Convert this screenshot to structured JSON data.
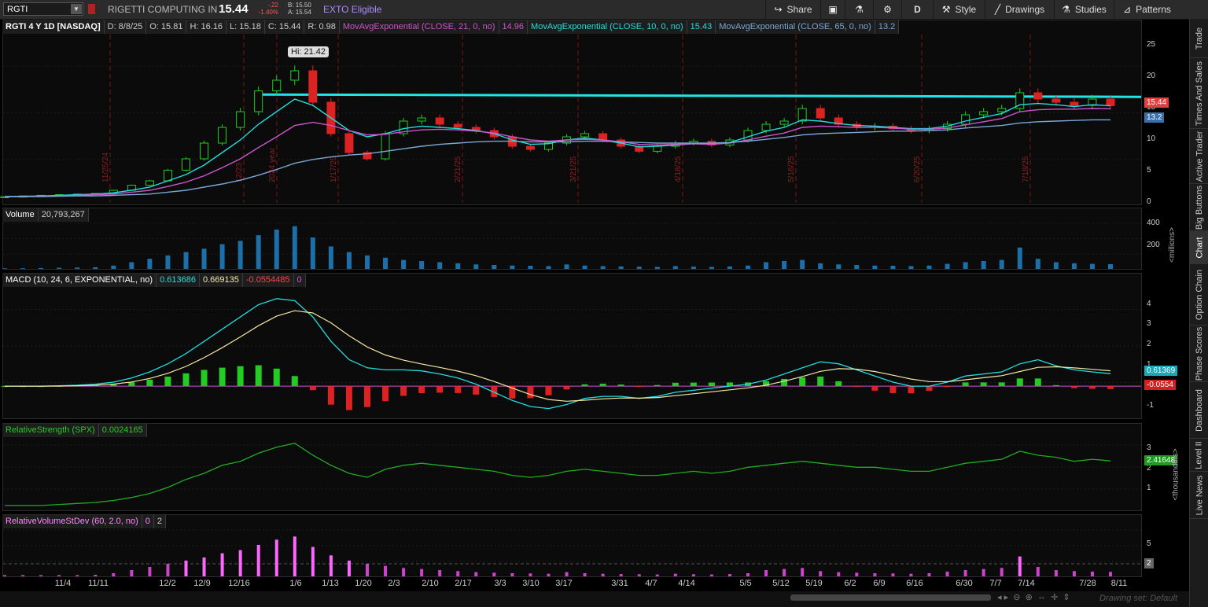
{
  "toolbar": {
    "symbol": "RGTI",
    "company": "RIGETTI COMPUTING IN",
    "last": "15.44",
    "change": "-.22",
    "change_pct": "-1.40%",
    "bid": "B: 15.50",
    "ask": "A: 15.54",
    "exto": "EXTO Eligible",
    "share": "Share",
    "period": "D",
    "style": "Style",
    "drawings": "Drawings",
    "studies": "Studies",
    "patterns": "Patterns"
  },
  "price_panel": {
    "header": {
      "title": "RGTI 4 Y 1D [NASDAQ]",
      "date": "D: 8/8/25",
      "open": "O: 15.81",
      "high": "H: 16.16",
      "low": "L: 15.18",
      "close": "C: 15.44",
      "range": "R: 0.98",
      "ema21_label": "MovAvgExponential (CLOSE, 21, 0, no)",
      "ema21_value": "14.96",
      "ema10_label": "MovAvgExponential (CLOSE, 10, 0, no)",
      "ema10_value": "15.43",
      "ema65_label": "MovAvgExponential (CLOSE, 65, 0, no)",
      "ema65_value": "13.2"
    },
    "hi_bubble": "Hi: 21.42",
    "y_ticks": [
      "25",
      "20",
      "15",
      "10",
      "5",
      "0"
    ],
    "price_tag": "15.44",
    "ema65_tag": "13.2",
    "event_labels": [
      "11/25/24",
      "12/23",
      "2024 year",
      "1/17/25",
      "2/21/25",
      "3/21/25",
      "4/18/25",
      "5/16/25",
      "6/20/25",
      "7/18/25"
    ],
    "resistance_level": 17.1
  },
  "volume_panel": {
    "title": "Volume",
    "value": "20,793,267",
    "y_ticks": [
      "400",
      "200"
    ],
    "unit": "<millions>"
  },
  "macd_panel": {
    "title": "MACD (10, 24, 6, EXPONENTIAL, no)",
    "value": "0.613686",
    "avg": "0.669135",
    "diff": "-0.0554485",
    "zero": "0",
    "y_ticks": [
      "4",
      "3",
      "2",
      "1",
      "-1"
    ],
    "value_tag": "0.61369",
    "diff_tag": "-0.0554"
  },
  "rs_panel": {
    "title": "RelativeStrength (SPX)",
    "value": "0.0024165",
    "y_ticks": [
      "3",
      "2",
      "1"
    ],
    "value_tag": "2.41648",
    "unit": "<thousandths>"
  },
  "rvs_panel": {
    "title": "RelativeVolumeStDev (60, 2.0, no)",
    "v1": "0",
    "v2": "2",
    "y_ticks": [
      "5"
    ],
    "value_tag": "2"
  },
  "x_axis": [
    "11/4",
    "11/11",
    "12/2",
    "12/9",
    "12/16",
    "1/6",
    "1/13",
    "1/20",
    "2/3",
    "2/10",
    "2/17",
    "3/3",
    "3/10",
    "3/17",
    "3/31",
    "4/7",
    "4/14",
    "5/5",
    "5/12",
    "5/19",
    "6/2",
    "6/9",
    "6/16",
    "6/30",
    "7/7",
    "7/14",
    "7/28",
    "8/11"
  ],
  "sidebar": [
    "Trade",
    "Times And Sales",
    "Active Trader",
    "Big Buttons",
    "Chart",
    "Option Chain",
    "Phase Scores",
    "Dashboard",
    "Level II",
    "Live News"
  ],
  "footer": {
    "drawing_set": "Drawing set: Default"
  },
  "colors": {
    "up": "#22cc22",
    "down": "#dd2222",
    "ema10": "#22dddd",
    "ema21": "#cc55cc",
    "ema65": "#7aa7d6",
    "resistance": "#22e4e4"
  },
  "chart_data": {
    "type": "line",
    "series": [
      {
        "name": "RGTI",
        "values": [
          1.0,
          1.1,
          1.2,
          1.3,
          1.4,
          1.5,
          2.0,
          2.8,
          3.5,
          5.2,
          7.0,
          9.5,
          12.0,
          14.5,
          17.8,
          19.5,
          21.0,
          16.0,
          11.0,
          8.0,
          7.0,
          11.0,
          13.0,
          13.5,
          12.5,
          12.0,
          11.5,
          10.5,
          9.0,
          8.5,
          9.5,
          10.5,
          11.0,
          10.0,
          9.0,
          8.2,
          9.0,
          9.5,
          9.8,
          9.2,
          10.0,
          11.5,
          12.5,
          13.0,
          15.0,
          13.5,
          12.5,
          12.0,
          12.2,
          11.8,
          11.5,
          11.8,
          12.5,
          14.0,
          14.5,
          15.0,
          17.5,
          16.5,
          16.0,
          15.5,
          16.5,
          15.44
        ]
      },
      {
        "name": "MovAvgExponential (CLOSE, 10, 0, no)",
        "values": [
          1.0,
          1.05,
          1.1,
          1.2,
          1.3,
          1.4,
          1.6,
          2.0,
          2.5,
          3.5,
          4.5,
          6.0,
          8.0,
          10.0,
          12.5,
          14.5,
          16.5,
          15.5,
          13.5,
          11.5,
          10.5,
          11.0,
          11.8,
          12.2,
          12.0,
          11.8,
          11.5,
          11.0,
          10.0,
          9.3,
          9.4,
          10.0,
          10.3,
          10.0,
          9.5,
          8.9,
          9.0,
          9.2,
          9.4,
          9.3,
          9.6,
          10.5,
          11.4,
          12.0,
          13.2,
          13.0,
          12.6,
          12.3,
          12.2,
          12.0,
          11.8,
          11.8,
          12.2,
          13.0,
          13.6,
          14.2,
          15.6,
          15.8,
          15.6,
          15.3,
          15.6,
          15.43
        ]
      },
      {
        "name": "MovAvgExponential (CLOSE, 21, 0, no)",
        "values": [
          1.0,
          1.0,
          1.05,
          1.1,
          1.2,
          1.3,
          1.4,
          1.7,
          2.0,
          2.6,
          3.3,
          4.3,
          5.6,
          7.0,
          8.8,
          10.5,
          12.3,
          12.8,
          12.3,
          11.5,
          10.8,
          10.9,
          11.3,
          11.6,
          11.7,
          11.6,
          11.4,
          11.1,
          10.5,
          10.0,
          9.8,
          10.0,
          10.1,
          10.0,
          9.7,
          9.3,
          9.2,
          9.3,
          9.4,
          9.3,
          9.5,
          10.0,
          10.6,
          11.1,
          12.0,
          12.2,
          12.1,
          12.0,
          12.0,
          11.9,
          11.7,
          11.7,
          11.9,
          12.4,
          12.9,
          13.4,
          14.5,
          14.8,
          14.9,
          14.9,
          15.0,
          14.96
        ]
      },
      {
        "name": "MovAvgExponential (CLOSE, 65, 0, no)",
        "values": [
          1.0,
          1.0,
          1.0,
          1.05,
          1.1,
          1.1,
          1.2,
          1.3,
          1.4,
          1.7,
          2.0,
          2.5,
          3.0,
          3.6,
          4.4,
          5.3,
          6.3,
          6.9,
          7.3,
          7.6,
          7.8,
          8.2,
          8.6,
          9.0,
          9.3,
          9.5,
          9.7,
          9.8,
          9.8,
          9.7,
          9.7,
          9.7,
          9.8,
          9.8,
          9.7,
          9.6,
          9.5,
          9.5,
          9.5,
          9.5,
          9.6,
          9.8,
          10.1,
          10.4,
          10.8,
          11.0,
          11.1,
          11.2,
          11.3,
          11.4,
          11.4,
          11.5,
          11.6,
          11.9,
          12.1,
          12.3,
          12.7,
          12.9,
          13.0,
          13.1,
          13.2,
          13.2
        ]
      }
    ],
    "volume_millions": [
      5,
      6,
      8,
      10,
      12,
      15,
      30,
      60,
      90,
      120,
      150,
      180,
      220,
      250,
      300,
      350,
      380,
      280,
      200,
      150,
      120,
      100,
      80,
      70,
      60,
      50,
      40,
      35,
      30,
      28,
      25,
      40,
      30,
      25,
      22,
      20,
      18,
      25,
      20,
      18,
      22,
      30,
      60,
      70,
      80,
      50,
      40,
      35,
      30,
      28,
      25,
      30,
      45,
      60,
      70,
      80,
      190,
      90,
      60,
      50,
      45,
      42
    ],
    "macd": [
      0,
      0,
      0,
      0.02,
      0.05,
      0.1,
      0.2,
      0.4,
      0.7,
      1.1,
      1.6,
      2.2,
      2.8,
      3.4,
      4.0,
      4.3,
      4.2,
      3.4,
      2.2,
      1.3,
      0.9,
      0.8,
      0.8,
      0.75,
      0.6,
      0.4,
      0.1,
      -0.3,
      -0.7,
      -1.0,
      -1.1,
      -0.9,
      -0.6,
      -0.5,
      -0.5,
      -0.6,
      -0.5,
      -0.3,
      -0.2,
      -0.1,
      0,
      0.1,
      0.3,
      0.6,
      0.9,
      1.2,
      1.1,
      0.8,
      0.5,
      0.2,
      0,
      0,
      0.2,
      0.5,
      0.6,
      0.7,
      1.1,
      1.3,
      1.0,
      0.8,
      0.7,
      0.61369
    ],
    "rs": [
      0.2,
      0.2,
      0.2,
      0.25,
      0.3,
      0.35,
      0.45,
      0.6,
      0.8,
      1.1,
      1.5,
      1.8,
      2.2,
      2.4,
      2.8,
      3.1,
      3.3,
      2.7,
      2.2,
      1.8,
      1.6,
      2.0,
      2.2,
      2.3,
      2.2,
      2.1,
      2.0,
      1.9,
      1.7,
      1.6,
      1.7,
      1.9,
      2.0,
      1.9,
      1.8,
      1.7,
      1.7,
      1.8,
      1.9,
      1.8,
      1.9,
      2.1,
      2.2,
      2.3,
      2.4,
      2.3,
      2.2,
      2.1,
      2.1,
      2.0,
      1.9,
      1.9,
      2.1,
      2.3,
      2.4,
      2.5,
      2.9,
      2.7,
      2.6,
      2.4,
      2.5,
      2.41648
    ],
    "y_range_price": [
      0,
      27
    ]
  }
}
